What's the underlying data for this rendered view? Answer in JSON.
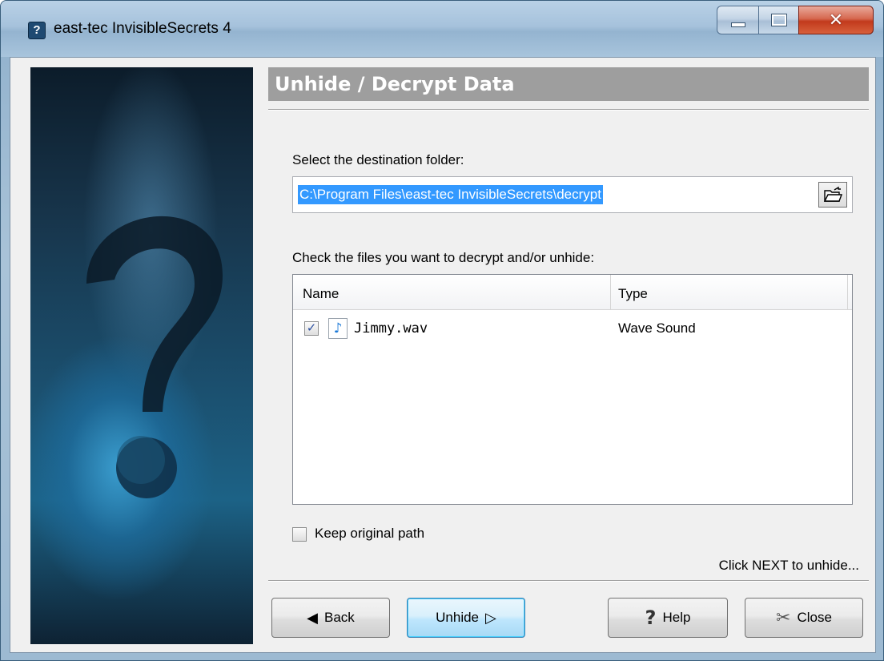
{
  "window": {
    "title": "east-tec InvisibleSecrets 4",
    "icon": "app-icon",
    "controls": [
      "minimize-icon",
      "maximize-icon",
      "close-icon"
    ]
  },
  "page": {
    "title": "Unhide / Decrypt Data"
  },
  "destination": {
    "label": "Select the destination folder:",
    "path": "C:\\Program Files\\east-tec InvisibleSecrets\\decrypt",
    "browse_icon": "open-folder-icon"
  },
  "files": {
    "label": "Check the files you want to decrypt and/or unhide:",
    "columns": [
      "Name",
      "Type"
    ],
    "rows": [
      {
        "checked": true,
        "icon": "audio-file-icon",
        "name": "Jimmy.wav",
        "type": "Wave Sound"
      }
    ]
  },
  "options": {
    "keep_path_label": "Keep original path",
    "keep_path_checked": false
  },
  "hint": "Click NEXT to unhide...",
  "buttons": {
    "back": "Back",
    "unhide": "Unhide",
    "help": "Help",
    "close": "Close"
  },
  "colors": {
    "title_band": "#9e9e9e",
    "selection": "#3399ff",
    "close_button": "#c23a1d"
  }
}
